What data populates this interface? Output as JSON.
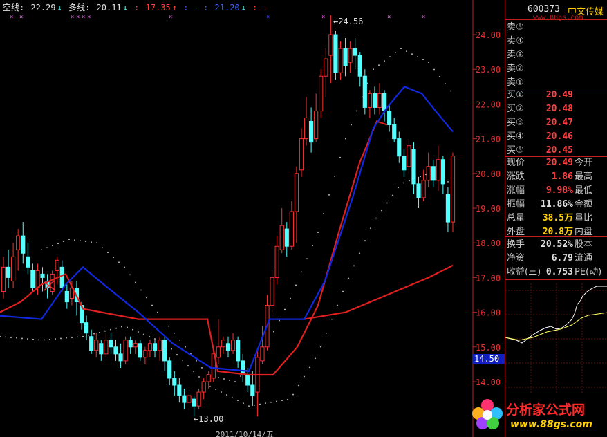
{
  "indicators": {
    "kong_label": "空线:",
    "kong_value": "22.29",
    "kong_arrow": "↓",
    "duo_label": "多线:",
    "duo_value": "20.11",
    "duo_arrow": "↓",
    "v3_label": ":",
    "v3_value": "17.35",
    "v3_arrow": "↑",
    "v4": ": - :",
    "v5_value": "21.20",
    "v5_arrow": "↓",
    "v6": ": -"
  },
  "chart": {
    "high_label": "24.56",
    "low_label": "13.00",
    "date_label": "2011/10/14/五",
    "yticks": [
      "24.00",
      "23.00",
      "22.00",
      "21.00",
      "20.00",
      "19.00",
      "18.00",
      "17.00",
      "16.00",
      "15.00",
      "14.00"
    ],
    "current_price_tag": "14.50",
    "colors": {
      "up": "#ff3030",
      "down": "#54ffff",
      "blue": "#1020e0",
      "red": "#e02020",
      "bg": "#000000",
      "grid": "#c02020"
    }
  },
  "quote": {
    "code": "600373",
    "name": "中文传媒",
    "watermark": "www.88gs.com",
    "sell": [
      {
        "label": "卖⑤",
        "price": ""
      },
      {
        "label": "卖④",
        "price": ""
      },
      {
        "label": "卖③",
        "price": ""
      },
      {
        "label": "卖②",
        "price": ""
      },
      {
        "label": "卖①",
        "price": ""
      }
    ],
    "buy": [
      {
        "label": "买①",
        "price": "20.49"
      },
      {
        "label": "买②",
        "price": "20.48"
      },
      {
        "label": "买③",
        "price": "20.47"
      },
      {
        "label": "买④",
        "price": "20.46"
      },
      {
        "label": "买⑤",
        "price": "20.45"
      }
    ],
    "stats": [
      {
        "k": "现价",
        "v": "20.49",
        "k2": "今开"
      },
      {
        "k": "涨跌",
        "v": "1.86",
        "k2": "最高"
      },
      {
        "k": "涨幅",
        "v": "9.98%",
        "k2": "最低"
      },
      {
        "k": "振幅",
        "v": "11.86%",
        "k2": "金额"
      },
      {
        "k": "总量",
        "v": "38.5万",
        "k2": "量比"
      },
      {
        "k": "外盘",
        "v": "20.8万",
        "k2": "内盘"
      },
      {
        "k": "换手",
        "v": "20.52%",
        "k2": "股本"
      },
      {
        "k": "净资",
        "v": "6.79",
        "k2": "流通"
      },
      {
        "k": "收益(三)",
        "v": "0.753",
        "k2": "PE(动)"
      }
    ]
  },
  "logo": {
    "title": "分析家公式网",
    "url": "www.88gs.com"
  }
}
